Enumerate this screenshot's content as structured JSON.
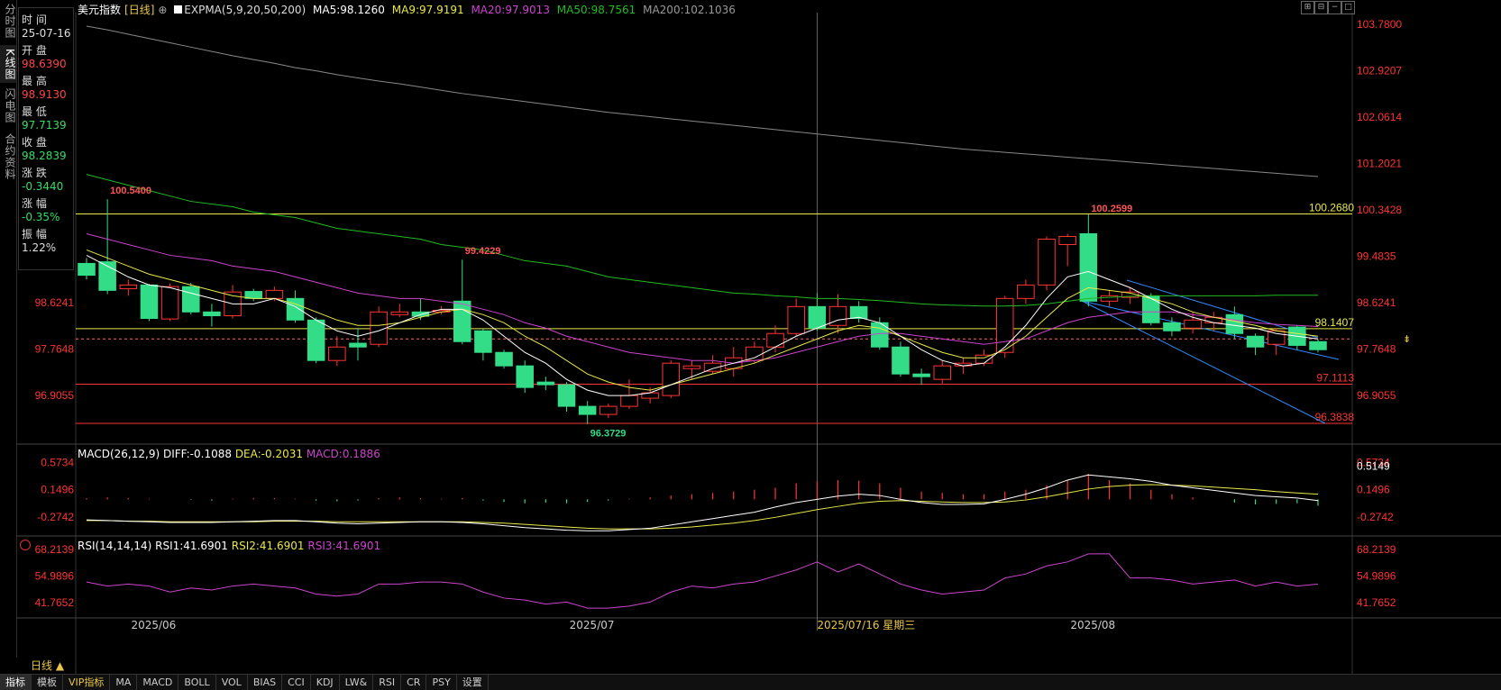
{
  "left_tabs": [
    "分时图",
    "K线图",
    "闪电图",
    "合约资料"
  ],
  "info_panel": [
    {
      "label": "时 间",
      "value": "25-07-16",
      "color": "#dddddd"
    },
    {
      "label": "开 盘",
      "value": "98.6390",
      "color": "#ff4444"
    },
    {
      "label": "最 高",
      "value": "98.9130",
      "color": "#ff4444"
    },
    {
      "label": "最 低",
      "value": "97.7139",
      "color": "#33dd66"
    },
    {
      "label": "收 盘",
      "value": "98.2839",
      "color": "#33dd66"
    },
    {
      "label": "涨 跌",
      "value": "-0.3440",
      "color": "#33dd66"
    },
    {
      "label": "涨 幅",
      "value": "-0.35%",
      "color": "#33dd66"
    },
    {
      "label": "振 幅",
      "value": "1.22%",
      "color": "#dddddd"
    }
  ],
  "main_legend": {
    "title": "美元指数",
    "period": "[日线]",
    "expma": "EXPMA(5,9,20,50,200)",
    "ma5": "MA5:98.1260",
    "ma9": "MA9:97.9191",
    "ma20": "MA20:97.9013",
    "ma50": "MA50:98.7561",
    "ma200": "MA200:102.1036"
  },
  "price_axis": [
    "103.7800",
    "102.9207",
    "102.0614",
    "101.2021",
    "100.3428",
    "99.4835",
    "98.6241",
    "97.7648",
    "96.9055"
  ],
  "price_axis_left": [
    "99.4835",
    "98.6241",
    "97.7648",
    "96.9055"
  ],
  "annotations": {
    "high1": "100.5400",
    "high2": "99.4229",
    "low1": "96.3729",
    "high3": "100.2599",
    "hline1": "100.2680",
    "hline2": "98.1407",
    "hline3": "97.1113",
    "hline4": "96.3838"
  },
  "macd_legend": {
    "title": "MACD(26,12,9)",
    "diff": "DIFF:-0.1088",
    "dea": "DEA:-0.2031",
    "macd": "MACD:0.1886"
  },
  "macd_axis": [
    "0.5734",
    "0.1496",
    "-0.2742"
  ],
  "macd_axis_right_extra": "0.5149",
  "rsi_legend": {
    "title": "RSI(14,14,14)",
    "rsi1": "RSI1:41.6901",
    "rsi2": "RSI2:41.6901",
    "rsi3": "RSI3:41.6901"
  },
  "rsi_axis": [
    "68.2139",
    "54.9896",
    "41.7652"
  ],
  "time_axis": [
    "2025/06",
    "2025/07",
    "2025/07/16 星期三",
    "2025/08"
  ],
  "period_button": "日线 ▲",
  "bottom_tabs": [
    "指标",
    "模板",
    "VIP指标",
    "MA",
    "MACD",
    "BOLL",
    "VOL",
    "BIAS",
    "CCI",
    "KDJ",
    "LW&",
    "RSI",
    "CR",
    "PSY",
    "设置"
  ],
  "colors": {
    "up": "#ff3333",
    "down": "#33dd88",
    "ma5": "#ffffff",
    "ma9": "#e8e84a",
    "ma20": "#cc44cc",
    "ma50": "#22bb22",
    "ma200": "#888888",
    "axis_text": "#ff3333"
  },
  "chart_data": {
    "type": "candlestick",
    "price_range": [
      96.0,
      104.0
    ],
    "candles": [
      {
        "o": 99.35,
        "c": 99.13,
        "h": 99.45,
        "l": 99.05
      },
      {
        "o": 99.38,
        "c": 98.85,
        "h": 100.54,
        "l": 98.78
      },
      {
        "o": 98.88,
        "c": 98.95,
        "h": 99.05,
        "l": 98.75
      },
      {
        "o": 98.95,
        "c": 98.33,
        "h": 98.97,
        "l": 98.28
      },
      {
        "o": 98.32,
        "c": 98.92,
        "h": 98.98,
        "l": 98.28
      },
      {
        "o": 98.92,
        "c": 98.45,
        "h": 98.99,
        "l": 98.4
      },
      {
        "o": 98.45,
        "c": 98.38,
        "h": 98.6,
        "l": 98.18
      },
      {
        "o": 98.38,
        "c": 98.82,
        "h": 98.95,
        "l": 98.33
      },
      {
        "o": 98.83,
        "c": 98.7,
        "h": 98.88,
        "l": 98.65
      },
      {
        "o": 98.7,
        "c": 98.85,
        "h": 98.92,
        "l": 98.65
      },
      {
        "o": 98.7,
        "c": 98.3,
        "h": 98.85,
        "l": 98.25
      },
      {
        "o": 98.3,
        "c": 97.55,
        "h": 98.35,
        "l": 97.5
      },
      {
        "o": 97.55,
        "c": 97.8,
        "h": 98.0,
        "l": 97.45
      },
      {
        "o": 97.87,
        "c": 97.8,
        "h": 98.15,
        "l": 97.55
      },
      {
        "o": 97.85,
        "c": 98.45,
        "h": 98.55,
        "l": 97.8
      },
      {
        "o": 98.4,
        "c": 98.45,
        "h": 98.6,
        "l": 98.35
      },
      {
        "o": 98.45,
        "c": 98.37,
        "h": 98.7,
        "l": 98.3
      },
      {
        "o": 98.45,
        "c": 98.48,
        "h": 98.56,
        "l": 98.4
      },
      {
        "o": 98.65,
        "c": 97.9,
        "h": 99.42,
        "l": 97.85
      },
      {
        "o": 98.1,
        "c": 97.7,
        "h": 98.15,
        "l": 97.55
      },
      {
        "o": 97.7,
        "c": 97.45,
        "h": 97.75,
        "l": 97.4
      },
      {
        "o": 97.45,
        "c": 97.05,
        "h": 97.55,
        "l": 96.95
      },
      {
        "o": 97.15,
        "c": 97.1,
        "h": 97.25,
        "l": 97.0
      },
      {
        "o": 97.1,
        "c": 96.7,
        "h": 97.15,
        "l": 96.6
      },
      {
        "o": 96.7,
        "c": 96.55,
        "h": 96.8,
        "l": 96.37
      },
      {
        "o": 96.55,
        "c": 96.7,
        "h": 96.75,
        "l": 96.48
      },
      {
        "o": 96.7,
        "c": 96.9,
        "h": 97.2,
        "l": 96.65
      },
      {
        "o": 96.85,
        "c": 96.95,
        "h": 97.05,
        "l": 96.75
      },
      {
        "o": 96.9,
        "c": 97.5,
        "h": 97.55,
        "l": 96.85
      },
      {
        "o": 97.4,
        "c": 97.45,
        "h": 97.55,
        "l": 97.2
      },
      {
        "o": 97.35,
        "c": 97.5,
        "h": 97.65,
        "l": 97.3
      },
      {
        "o": 97.4,
        "c": 97.6,
        "h": 97.8,
        "l": 97.25
      },
      {
        "o": 97.55,
        "c": 97.8,
        "h": 97.9,
        "l": 97.5
      },
      {
        "o": 97.8,
        "c": 98.05,
        "h": 98.2,
        "l": 97.7
      },
      {
        "o": 98.05,
        "c": 98.55,
        "h": 98.7,
        "l": 98.0
      },
      {
        "o": 98.55,
        "c": 98.15,
        "h": 98.8,
        "l": 98.1
      },
      {
        "o": 98.2,
        "c": 98.55,
        "h": 98.78,
        "l": 98.05
      },
      {
        "o": 98.55,
        "c": 98.33,
        "h": 98.65,
        "l": 98.25
      },
      {
        "o": 98.25,
        "c": 97.8,
        "h": 98.35,
        "l": 97.75
      },
      {
        "o": 97.8,
        "c": 97.3,
        "h": 97.9,
        "l": 97.25
      },
      {
        "o": 97.3,
        "c": 97.25,
        "h": 97.4,
        "l": 97.1
      },
      {
        "o": 97.2,
        "c": 97.45,
        "h": 97.55,
        "l": 97.1
      },
      {
        "o": 97.45,
        "c": 97.5,
        "h": 97.6,
        "l": 97.3
      },
      {
        "o": 97.5,
        "c": 97.65,
        "h": 97.75,
        "l": 97.45
      },
      {
        "o": 97.7,
        "c": 98.7,
        "h": 98.75,
        "l": 97.6
      },
      {
        "o": 98.7,
        "c": 98.95,
        "h": 99.05,
        "l": 98.6
      },
      {
        "o": 98.95,
        "c": 99.8,
        "h": 99.85,
        "l": 98.85
      },
      {
        "o": 99.7,
        "c": 99.85,
        "h": 99.9,
        "l": 99.3
      },
      {
        "o": 99.9,
        "c": 98.65,
        "h": 100.26,
        "l": 98.55
      },
      {
        "o": 98.65,
        "c": 98.75,
        "h": 98.85,
        "l": 98.55
      },
      {
        "o": 98.72,
        "c": 98.82,
        "h": 98.9,
        "l": 98.6
      },
      {
        "o": 98.75,
        "c": 98.25,
        "h": 98.8,
        "l": 98.2
      },
      {
        "o": 98.25,
        "c": 98.1,
        "h": 98.35,
        "l": 98.0
      },
      {
        "o": 98.15,
        "c": 98.3,
        "h": 98.45,
        "l": 98.05
      },
      {
        "o": 98.25,
        "c": 98.35,
        "h": 98.45,
        "l": 98.1
      },
      {
        "o": 98.4,
        "c": 98.05,
        "h": 98.55,
        "l": 97.95
      },
      {
        "o": 98.0,
        "c": 97.8,
        "h": 98.05,
        "l": 97.65
      },
      {
        "o": 97.85,
        "c": 98.1,
        "h": 98.15,
        "l": 97.65
      },
      {
        "o": 98.17,
        "c": 97.83,
        "h": 98.2,
        "l": 97.75
      },
      {
        "o": 97.9,
        "c": 97.75,
        "h": 97.95,
        "l": 97.7
      }
    ],
    "ma5": [
      99.5,
      99.3,
      99.1,
      98.95,
      98.9,
      98.8,
      98.7,
      98.6,
      98.6,
      98.7,
      98.55,
      98.3,
      98.1,
      98.0,
      98.1,
      98.25,
      98.4,
      98.5,
      98.5,
      98.3,
      98.0,
      97.7,
      97.5,
      97.2,
      97.0,
      96.9,
      96.9,
      96.95,
      97.1,
      97.25,
      97.4,
      97.5,
      97.6,
      97.8,
      98.0,
      98.15,
      98.3,
      98.35,
      98.25,
      98.0,
      97.75,
      97.55,
      97.45,
      97.5,
      97.8,
      98.2,
      98.7,
      99.1,
      99.2,
      99.05,
      98.9,
      98.7,
      98.5,
      98.35,
      98.25,
      98.2,
      98.15,
      98.05,
      98.0,
      97.95
    ],
    "ma9": [
      99.6,
      99.45,
      99.3,
      99.15,
      99.05,
      98.95,
      98.85,
      98.75,
      98.7,
      98.7,
      98.6,
      98.45,
      98.3,
      98.2,
      98.2,
      98.25,
      98.35,
      98.45,
      98.5,
      98.4,
      98.25,
      98.0,
      97.8,
      97.55,
      97.3,
      97.15,
      97.05,
      97.0,
      97.1,
      97.2,
      97.3,
      97.4,
      97.5,
      97.65,
      97.8,
      97.95,
      98.1,
      98.2,
      98.15,
      98.0,
      97.85,
      97.7,
      97.6,
      97.6,
      97.75,
      98.0,
      98.35,
      98.7,
      98.9,
      98.85,
      98.8,
      98.7,
      98.6,
      98.45,
      98.35,
      98.28,
      98.2,
      98.1,
      98.05,
      98.0
    ],
    "ma20": [
      99.9,
      99.8,
      99.7,
      99.6,
      99.5,
      99.45,
      99.4,
      99.3,
      99.25,
      99.2,
      99.1,
      99.0,
      98.9,
      98.8,
      98.75,
      98.7,
      98.7,
      98.65,
      98.6,
      98.5,
      98.4,
      98.25,
      98.15,
      98.0,
      97.9,
      97.8,
      97.7,
      97.65,
      97.6,
      97.55,
      97.55,
      97.5,
      97.55,
      97.6,
      97.7,
      97.8,
      97.9,
      98.0,
      98.05,
      98.05,
      98.0,
      97.95,
      97.9,
      97.85,
      97.9,
      97.95,
      98.1,
      98.25,
      98.35,
      98.4,
      98.45,
      98.45,
      98.45,
      98.4,
      98.35,
      98.3,
      98.25,
      98.22,
      98.2,
      98.18
    ],
    "ma50": [
      101.0,
      100.9,
      100.8,
      100.7,
      100.6,
      100.5,
      100.45,
      100.4,
      100.3,
      100.25,
      100.2,
      100.1,
      100.0,
      99.95,
      99.9,
      99.85,
      99.8,
      99.7,
      99.65,
      99.6,
      99.5,
      99.4,
      99.35,
      99.3,
      99.2,
      99.1,
      99.05,
      99.0,
      98.95,
      98.9,
      98.85,
      98.8,
      98.78,
      98.75,
      98.73,
      98.7,
      98.7,
      98.68,
      98.66,
      98.63,
      98.6,
      98.58,
      98.57,
      98.56,
      98.56,
      98.57,
      98.6,
      98.65,
      98.7,
      98.72,
      98.74,
      98.75,
      98.75,
      98.75,
      98.75,
      98.75,
      98.75,
      98.76,
      98.76,
      98.76
    ],
    "ma200": [
      103.75,
      103.68,
      103.6,
      103.52,
      103.44,
      103.36,
      103.28,
      103.2,
      103.13,
      103.06,
      102.98,
      102.92,
      102.85,
      102.79,
      102.73,
      102.68,
      102.62,
      102.56,
      102.5,
      102.45,
      102.4,
      102.35,
      102.3,
      102.25,
      102.2,
      102.15,
      102.11,
      102.07,
      102.03,
      101.99,
      101.95,
      101.91,
      101.87,
      101.83,
      101.79,
      101.75,
      101.71,
      101.67,
      101.63,
      101.59,
      101.55,
      101.51,
      101.47,
      101.44,
      101.41,
      101.38,
      101.35,
      101.32,
      101.29,
      101.26,
      101.23,
      101.2,
      101.17,
      101.14,
      101.11,
      101.08,
      101.05,
      101.02,
      100.99,
      100.96
    ],
    "macd_range": [
      -0.5,
      0.65
    ],
    "macd_hist": [
      0.02,
      0.03,
      0.02,
      0.01,
      0.0,
      -0.01,
      -0.02,
      0.01,
      0.02,
      0.02,
      0.01,
      -0.02,
      -0.03,
      -0.02,
      0.02,
      0.03,
      0.02,
      0.01,
      0.02,
      -0.02,
      -0.04,
      -0.06,
      -0.05,
      -0.06,
      -0.04,
      -0.02,
      0.01,
      0.03,
      0.06,
      0.08,
      0.1,
      0.12,
      0.15,
      0.18,
      0.25,
      0.28,
      0.3,
      0.29,
      0.25,
      0.18,
      0.12,
      0.1,
      0.08,
      0.08,
      0.12,
      0.15,
      0.22,
      0.3,
      0.4,
      0.3,
      0.25,
      0.15,
      0.08,
      0.03,
      0.0,
      -0.05,
      -0.08,
      -0.07,
      -0.06,
      -0.1
    ],
    "macd_diff": [
      -0.32,
      -0.33,
      -0.34,
      -0.35,
      -0.36,
      -0.36,
      -0.36,
      -0.35,
      -0.34,
      -0.33,
      -0.33,
      -0.35,
      -0.37,
      -0.38,
      -0.37,
      -0.36,
      -0.35,
      -0.35,
      -0.36,
      -0.38,
      -0.41,
      -0.44,
      -0.46,
      -0.48,
      -0.49,
      -0.49,
      -0.47,
      -0.45,
      -0.4,
      -0.35,
      -0.3,
      -0.25,
      -0.2,
      -0.12,
      -0.05,
      0.0,
      0.05,
      0.08,
      0.06,
      0.0,
      -0.05,
      -0.08,
      -0.08,
      -0.07,
      0.0,
      0.08,
      0.18,
      0.3,
      0.38,
      0.35,
      0.32,
      0.28,
      0.22,
      0.18,
      0.14,
      0.1,
      0.06,
      0.04,
      0.02,
      -0.02
    ],
    "macd_dea": [
      -0.33,
      -0.33,
      -0.34,
      -0.34,
      -0.35,
      -0.35,
      -0.35,
      -0.35,
      -0.35,
      -0.34,
      -0.34,
      -0.34,
      -0.35,
      -0.35,
      -0.35,
      -0.35,
      -0.35,
      -0.35,
      -0.35,
      -0.36,
      -0.37,
      -0.39,
      -0.41,
      -0.43,
      -0.45,
      -0.46,
      -0.46,
      -0.46,
      -0.45,
      -0.43,
      -0.4,
      -0.37,
      -0.33,
      -0.28,
      -0.22,
      -0.16,
      -0.11,
      -0.06,
      -0.03,
      -0.02,
      -0.03,
      -0.04,
      -0.05,
      -0.05,
      -0.04,
      -0.01,
      0.04,
      0.1,
      0.16,
      0.2,
      0.22,
      0.23,
      0.22,
      0.21,
      0.19,
      0.17,
      0.15,
      0.12,
      0.1,
      0.08
    ],
    "rsi_range": [
      35,
      70
    ],
    "rsi": [
      52,
      50,
      51,
      50,
      47,
      49,
      48,
      50,
      51,
      50,
      49,
      46,
      45,
      46,
      51,
      51,
      52,
      52,
      51,
      47,
      44,
      43,
      41,
      42,
      39,
      39,
      40,
      42,
      47,
      50,
      49,
      51,
      52,
      55,
      58,
      62,
      57,
      61,
      56,
      51,
      48,
      46,
      47,
      48,
      54,
      56,
      60,
      62,
      66,
      66,
      54,
      54,
      53,
      51,
      52,
      53,
      50,
      52,
      50,
      51
    ]
  }
}
